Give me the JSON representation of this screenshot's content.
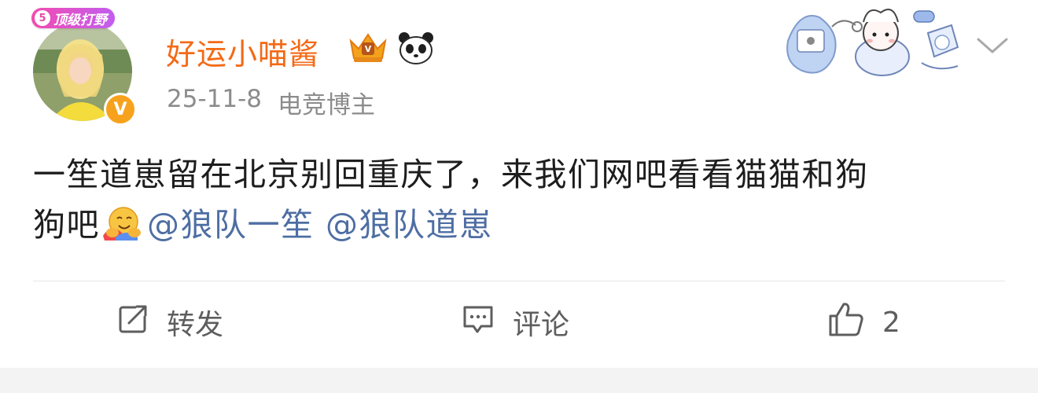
{
  "author": {
    "avatar_badge_num": "5",
    "avatar_badge": "顶级打野",
    "verify_mark": "V",
    "name": "好运小喵酱",
    "name_icons": [
      "crown-vip-icon",
      "panda-icon"
    ]
  },
  "meta": {
    "date": "25-11-8",
    "role": "电竞博主"
  },
  "post": {
    "text_line1": "一笙道崽留在北京别回重庆了，来我们网吧看看猫猫和狗",
    "text_line2": "狗吧",
    "emoji": "hugging-face-icon",
    "mentions": [
      "@狼队一笙",
      "@狼队道崽"
    ]
  },
  "actions": {
    "repost_label": "转发",
    "comment_label": "评论",
    "like_count": "2"
  },
  "colors": {
    "username": "#f36a16",
    "mention": "#4e6ea3",
    "meta": "#8c8c8c",
    "action": "#5e5e5e"
  }
}
